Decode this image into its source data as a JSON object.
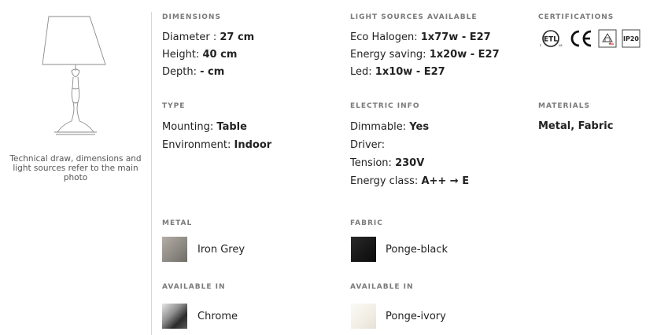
{
  "drawing": {
    "caption": "Technical draw, dimensions and light sources refer to the main photo"
  },
  "dimensions": {
    "heading": "DIMENSIONS",
    "rows": [
      {
        "label": "Diameter : ",
        "value": "27 cm"
      },
      {
        "label": "Height: ",
        "value": "40 cm"
      },
      {
        "label": "Depth: ",
        "value": "- cm"
      }
    ]
  },
  "light_sources": {
    "heading": "LIGHT SOURCES AVAILABLE",
    "rows": [
      {
        "label": "Eco Halogen: ",
        "value": "1x77w - E27"
      },
      {
        "label": "Energy saving: ",
        "value": "1x20w - E27"
      },
      {
        "label": "Led: ",
        "value": "1x10w - E27"
      }
    ]
  },
  "certifications": {
    "heading": "CERTIFICATIONS",
    "icons": [
      "etl-icon",
      "ce-icon",
      "class2-icon",
      "ip20-icon"
    ],
    "ip_label": "IP20"
  },
  "type": {
    "heading": "TYPE",
    "rows": [
      {
        "label": "Mounting: ",
        "value": "Table"
      },
      {
        "label": "Environment: ",
        "value": "Indoor"
      }
    ]
  },
  "electric": {
    "heading": "ELECTRIC INFO",
    "rows": [
      {
        "label": "Dimmable: ",
        "value": "Yes"
      },
      {
        "label": "Driver: ",
        "value": ""
      },
      {
        "label": "Tension: ",
        "value": "230V"
      },
      {
        "label": "Energy class: ",
        "value": "A++ → E"
      }
    ]
  },
  "materials": {
    "heading": "MATERIALS",
    "value": "Metal, Fabric"
  },
  "metal": {
    "heading": "METAL",
    "swatch_label": "Iron Grey",
    "swatch_color": "#8e8a84"
  },
  "fabric": {
    "heading": "FABRIC",
    "swatch_label": "Ponge-black",
    "swatch_color": "#171616"
  },
  "metal_available": {
    "heading": "AVAILABLE IN",
    "swatch_label": "Chrome",
    "swatch_color": "#9a9a9a"
  },
  "fabric_available": {
    "heading": "AVAILABLE IN",
    "swatch_label": "Ponge-ivory",
    "swatch_color": "#f4f1ea"
  }
}
